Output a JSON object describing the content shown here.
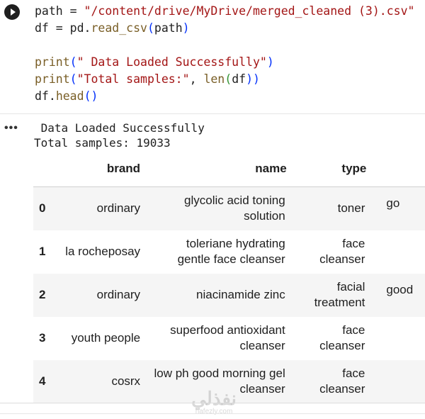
{
  "code_cell": {
    "line1": {
      "a": "path = ",
      "b": "\"/content/drive/MyDrive/merged_cleaned (3).csv\""
    },
    "line2": {
      "a": "df = pd.",
      "b": "read_csv",
      "c": "(",
      "d": "path",
      "e": ")"
    },
    "line4": {
      "a": "print",
      "b": "(",
      "c": "\" Data Loaded Successfully\"",
      "d": ")"
    },
    "line5": {
      "a": "print",
      "b": "(",
      "c": "\"Total samples:\"",
      "d": ", ",
      "e": "len",
      "f": "(",
      "g": "df",
      "h": "))"
    },
    "line6": {
      "a": "df.",
      "b": "head",
      "c": "()"
    }
  },
  "output": {
    "menu_icon": "more-horizontal-icon",
    "stdout_line1": " Data Loaded Successfully",
    "stdout_line2": "Total samples: 19033"
  },
  "dataframe": {
    "columns": [
      "brand",
      "name",
      "type"
    ],
    "rows": [
      {
        "index": "0",
        "brand": "ordinary",
        "name": "glycolic acid toning solution",
        "type": "toner",
        "extra": "go"
      },
      {
        "index": "1",
        "brand": "la rocheposay",
        "name": "toleriane hydrating gentle face cleanser",
        "type": "face cleanser",
        "extra": ""
      },
      {
        "index": "2",
        "brand": "ordinary",
        "name": "niacinamide zinc",
        "type": "facial treatment",
        "extra": "good"
      },
      {
        "index": "3",
        "brand": "youth people",
        "name": "superfood antioxidant cleanser",
        "type": "face cleanser",
        "extra": ""
      },
      {
        "index": "4",
        "brand": "cosrx",
        "name": "low ph good morning gel cleanser",
        "type": "face cleanser",
        "extra": ""
      }
    ]
  },
  "watermark": {
    "main": "نفذلي",
    "sub": "nafezly.com"
  },
  "colors": {
    "string": "#a31515",
    "function": "#795e26",
    "paren": "#0431fa",
    "paren_nested": "#319331",
    "row_stripe": "#f5f5f5"
  }
}
